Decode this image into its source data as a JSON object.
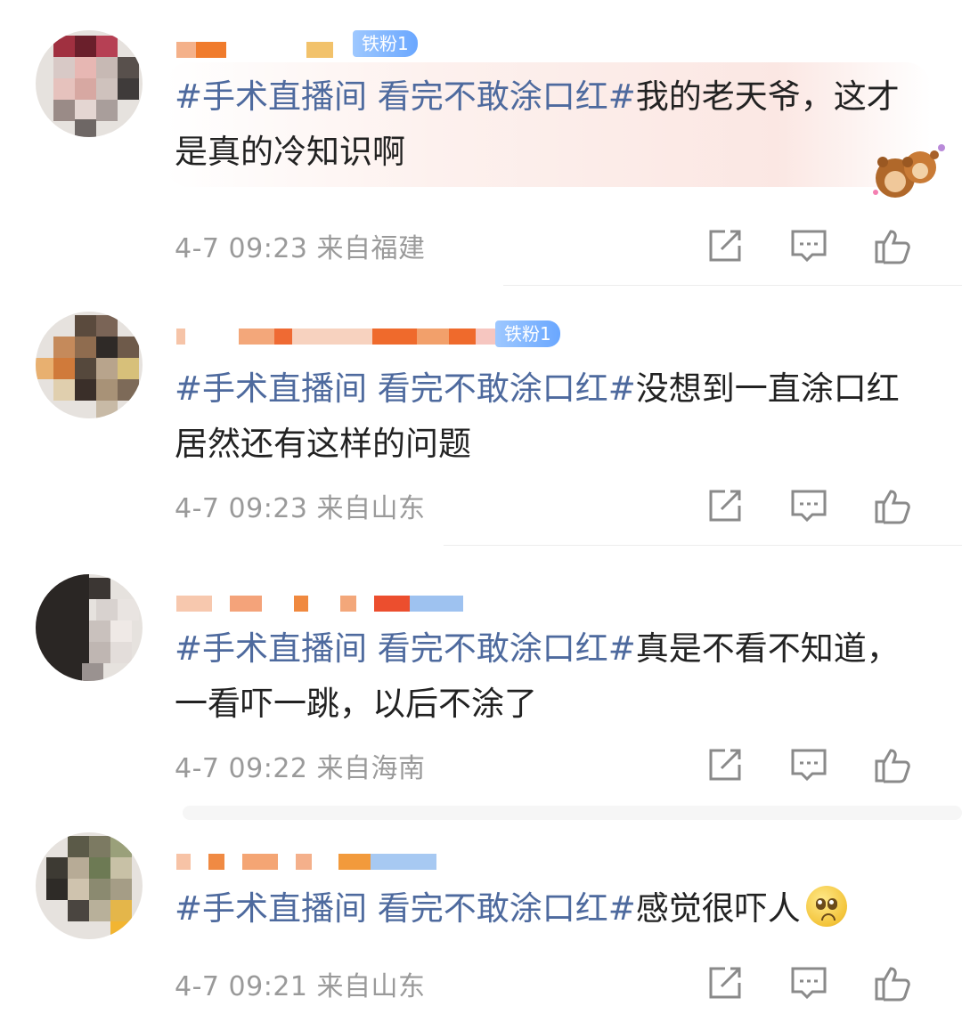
{
  "icons": {
    "share": "share-icon",
    "comment": "comment-icon",
    "like": "thumbs-up-icon",
    "emoji": "worried-face-emoji"
  },
  "colors": {
    "hashtag": "#4e6a9e",
    "meta": "#9a9a9a",
    "badge": "#6aa7ff"
  },
  "comments": [
    {
      "badge": "铁粉1",
      "hashtag": "#手术直播间 看完不敢涂口红#",
      "text": "我的老天爷，这才是真的冷知识啊",
      "time": "4-7 09:23",
      "location": "来自福建"
    },
    {
      "badge": "铁粉1",
      "hashtag": "#手术直播间 看完不敢涂口红#",
      "text": "没想到一直涂口红居然还有这样的问题",
      "time": "4-7 09:23",
      "location": "来自山东"
    },
    {
      "hashtag": "#手术直播间 看完不敢涂口红#",
      "text": "真是不看不知道，一看吓一跳，以后不涂了",
      "time": "4-7 09:22",
      "location": "来自海南"
    },
    {
      "hashtag": "#手术直播间 看完不敢涂口红#",
      "text": "感觉很吓人",
      "time": "4-7 09:21",
      "location": "来自山东"
    }
  ]
}
